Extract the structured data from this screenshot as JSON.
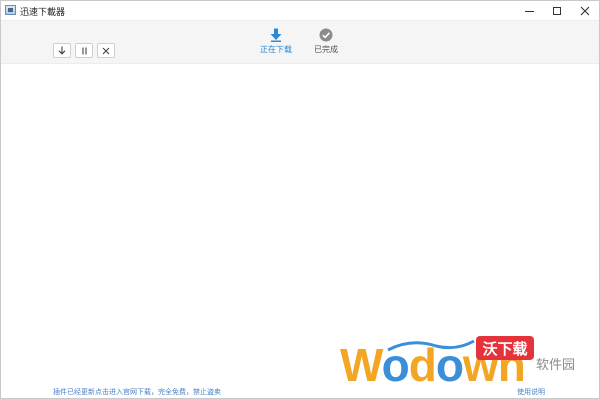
{
  "window": {
    "title": "迅速下載器"
  },
  "toolbar": {
    "tabs": [
      {
        "label": "正在下载",
        "icon": "download-arrow-icon",
        "active": true
      },
      {
        "label": "已完成",
        "icon": "check-circle-icon",
        "active": false
      }
    ],
    "actions": [
      {
        "icon": "arrow-down-icon"
      },
      {
        "icon": "pause-icon"
      },
      {
        "icon": "close-icon"
      }
    ]
  },
  "footer": {
    "notice": "插件已经更新点击进入官网下载，完全免费，禁止盗卖",
    "link": "使用说明"
  },
  "watermark": {
    "word_prefix": "W",
    "word_o1": "o",
    "word_mid": "d",
    "word_o2": "o",
    "word_suffix": "wn",
    "badge": "沃下载",
    "sub": "软件园"
  },
  "colors": {
    "accent": "#2a8ad4",
    "toolbar_bg": "#f5f5f5",
    "link": "#4a80c4",
    "watermark_orange": "#f3a623",
    "watermark_blue": "#3b8fd8",
    "badge_red": "#e5323b"
  }
}
